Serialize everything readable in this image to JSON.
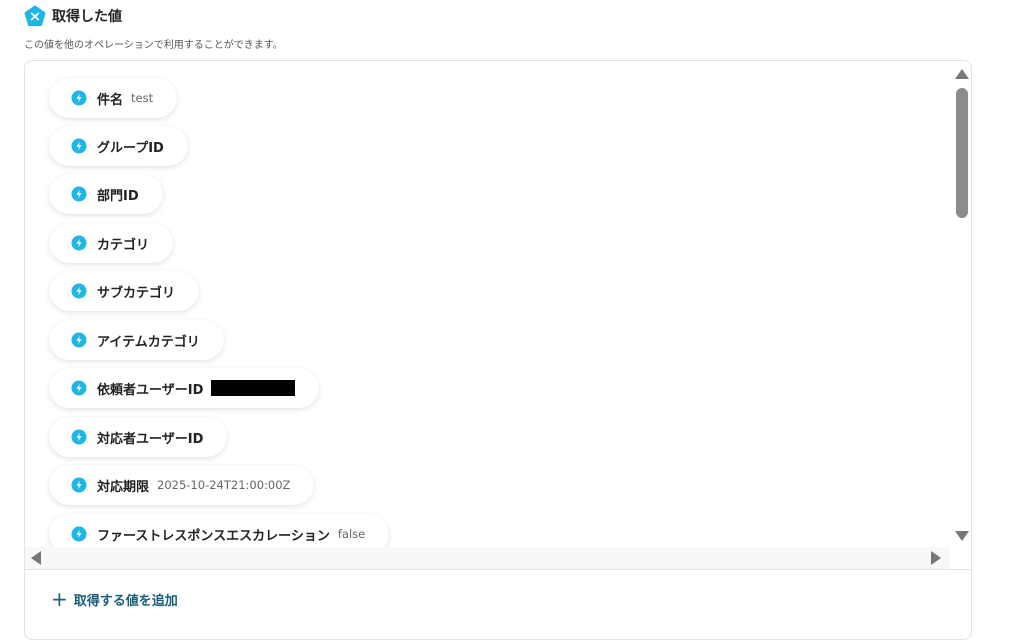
{
  "header": {
    "title": "取得した値",
    "subtitle": "この値を他のオペレーションで利用することができます。",
    "icon": "pentagon-x-icon",
    "accent_color": "#1fb5e6"
  },
  "items": [
    {
      "label": "件名",
      "value": "test"
    },
    {
      "label": "グループID",
      "value": ""
    },
    {
      "label": "部門ID",
      "value": ""
    },
    {
      "label": "カテゴリ",
      "value": ""
    },
    {
      "label": "サブカテゴリ",
      "value": ""
    },
    {
      "label": "アイテムカテゴリ",
      "value": ""
    },
    {
      "label": "依頼者ユーザーID",
      "value": "",
      "redacted": true
    },
    {
      "label": "対応者ユーザーID",
      "value": ""
    },
    {
      "label": "対応期限",
      "value": "2025-10-24T21:00:00Z"
    },
    {
      "label": "ファーストレスポンスエスカレーション",
      "value": "false"
    }
  ],
  "item_icon": "lightning-bolt-icon",
  "add_button": {
    "icon": "plus-icon",
    "label": "取得する値を追加"
  }
}
